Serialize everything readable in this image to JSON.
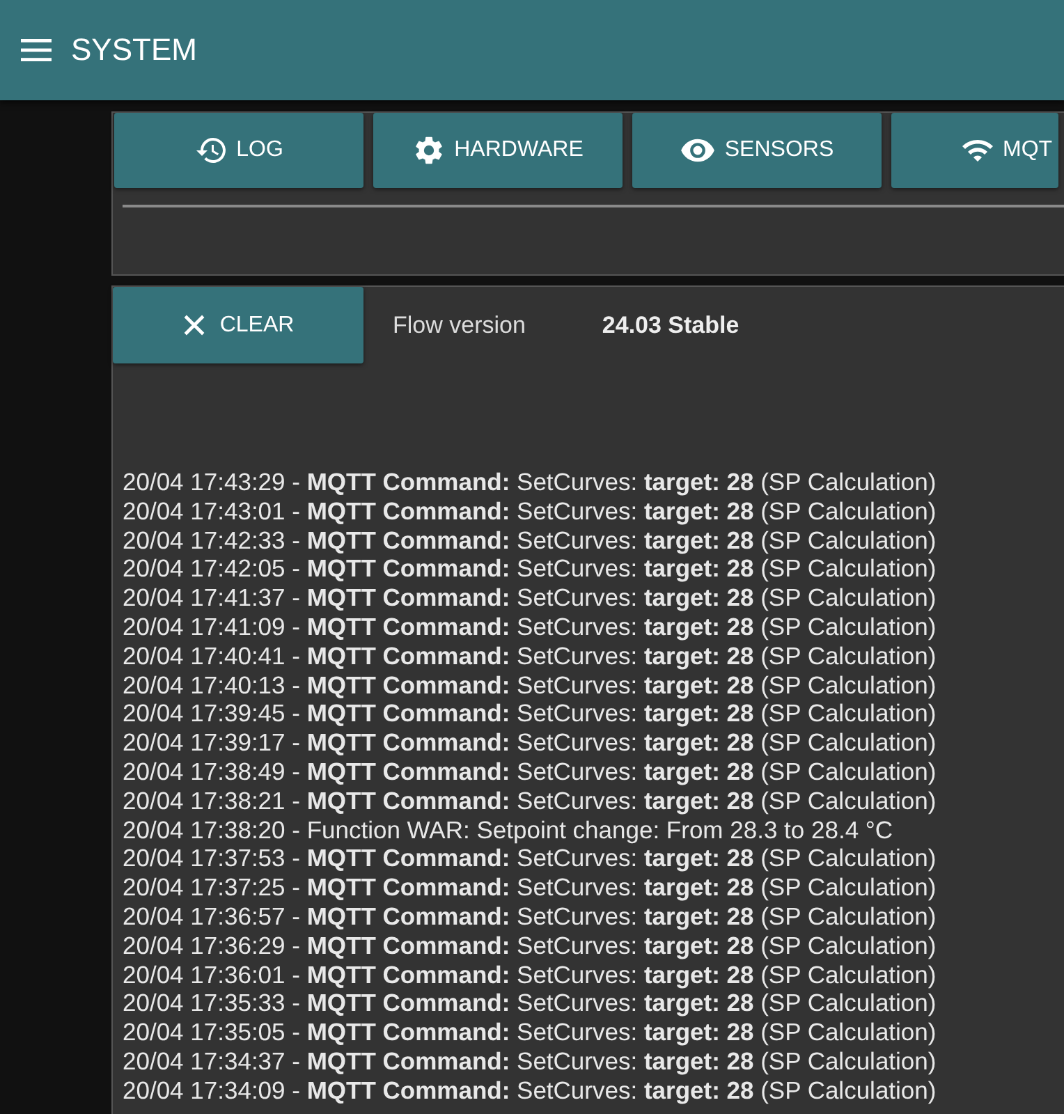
{
  "app_bar": {
    "title": "SYSTEM"
  },
  "tabs": [
    {
      "label": "LOG",
      "kind": "history"
    },
    {
      "label": "HARDWARE",
      "kind": "gear"
    },
    {
      "label": "SENSORS",
      "kind": "eye"
    },
    {
      "label": "MQT",
      "kind": "wifi"
    }
  ],
  "log_panel": {
    "clear_button": "CLEAR",
    "version_label": "Flow version",
    "version_value": "24.03 Stable",
    "lines": [
      "20/04 17:43:29 - **MQTT Command:** SetCurves: **target: 28** (SP Calculation)",
      "20/04 17:43:01 - **MQTT Command:** SetCurves: **target: 28** (SP Calculation)",
      "20/04 17:42:33 - **MQTT Command:** SetCurves: **target: 28** (SP Calculation)",
      "20/04 17:42:05 - **MQTT Command:** SetCurves: **target: 28** (SP Calculation)",
      "20/04 17:41:37 - **MQTT Command:** SetCurves: **target: 28** (SP Calculation)",
      "20/04 17:41:09 - **MQTT Command:** SetCurves: **target: 28** (SP Calculation)",
      "20/04 17:40:41 - **MQTT Command:** SetCurves: **target: 28** (SP Calculation)",
      "20/04 17:40:13 - **MQTT Command:** SetCurves: **target: 28** (SP Calculation)",
      "20/04 17:39:45 - **MQTT Command:** SetCurves: **target: 28** (SP Calculation)",
      "20/04 17:39:17 - **MQTT Command:** SetCurves: **target: 28** (SP Calculation)",
      "20/04 17:38:49 - **MQTT Command:** SetCurves: **target: 28** (SP Calculation)",
      "20/04 17:38:21 - **MQTT Command:** SetCurves: **target: 28** (SP Calculation)",
      "20/04 17:38:20 - Function WAR: Setpoint change: From 28.3 to 28.4 °C",
      "20/04 17:37:53 - **MQTT Command:** SetCurves: **target: 28** (SP Calculation)",
      "20/04 17:37:25 - **MQTT Command:** SetCurves: **target: 28** (SP Calculation)",
      "20/04 17:36:57 - **MQTT Command:** SetCurves: **target: 28** (SP Calculation)",
      "20/04 17:36:29 - **MQTT Command:** SetCurves: **target: 28** (SP Calculation)",
      "20/04 17:36:01 - **MQTT Command:** SetCurves: **target: 28** (SP Calculation)",
      "20/04 17:35:33 - **MQTT Command:** SetCurves: **target: 28** (SP Calculation)",
      "20/04 17:35:05 - **MQTT Command:** SetCurves: **target: 28** (SP Calculation)",
      "20/04 17:34:37 - **MQTT Command:** SetCurves: **target: 28** (SP Calculation)",
      "20/04 17:34:09 - **MQTT Command:** SetCurves: **target: 28** (SP Calculation)"
    ]
  }
}
